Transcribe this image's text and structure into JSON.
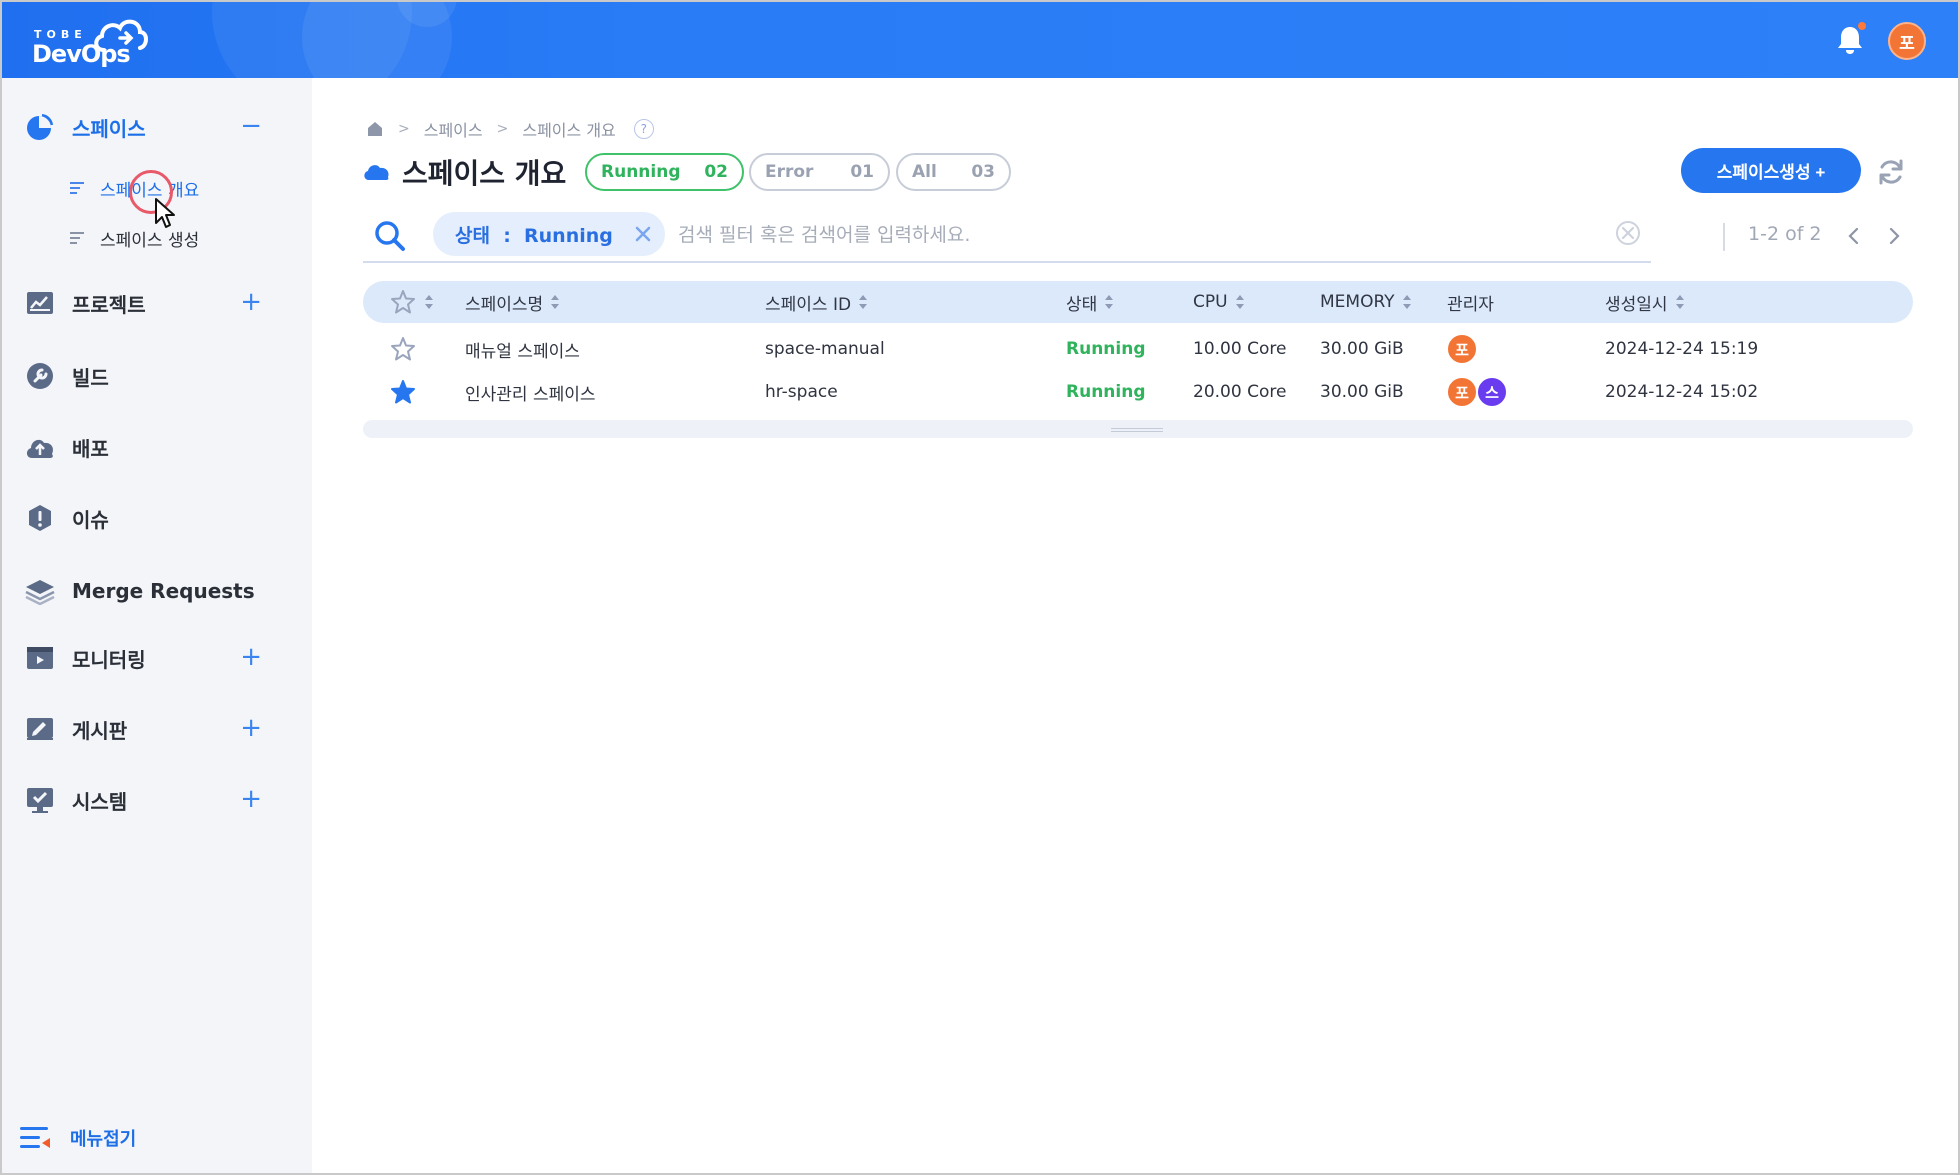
{
  "app": {
    "logo_small": "TOBE",
    "logo_main": "DevOps",
    "user_initial": "포"
  },
  "colors": {
    "brand": "#2676f0",
    "running": "#2fb35c",
    "avatar_orange": "#f27535",
    "avatar_purple": "#6a3cf0"
  },
  "sidebar": {
    "items": [
      {
        "label": "스페이스",
        "icon": "pie-chart-icon",
        "toggle": "−"
      },
      {
        "label": "프로젝트",
        "icon": "project-chart-icon",
        "toggle": "+"
      },
      {
        "label": "빌드",
        "icon": "wrench-icon",
        "toggle": ""
      },
      {
        "label": "배포",
        "icon": "cloud-upload-icon",
        "toggle": ""
      },
      {
        "label": "이슈",
        "icon": "alert-icon",
        "toggle": ""
      },
      {
        "label": "Merge Requests",
        "icon": "layers-icon",
        "toggle": ""
      },
      {
        "label": "모니터링",
        "icon": "monitor-icon",
        "toggle": "+"
      },
      {
        "label": "게시판",
        "icon": "board-icon",
        "toggle": "+"
      },
      {
        "label": "시스템",
        "icon": "system-icon",
        "toggle": "+"
      }
    ],
    "sub_items": [
      {
        "label": "스페이스 개요"
      },
      {
        "label": "스페이스 생성"
      }
    ],
    "fold_label": "메뉴접기"
  },
  "breadcrumb": [
    "스페이스",
    "스페이스 개요"
  ],
  "help": "?",
  "page_title": "스페이스 개요",
  "status_chips": [
    {
      "label": "Running",
      "count": "02"
    },
    {
      "label": "Error",
      "count": "01"
    },
    {
      "label": "All",
      "count": "03"
    }
  ],
  "create_button": "스페이스생성 +",
  "search": {
    "filter_label": "상태  :  Running",
    "placeholder": "검색 필터 혹은 검색어를 입력하세요."
  },
  "pager": {
    "text": "1-2 of 2"
  },
  "table": {
    "headers": [
      "스페이스명",
      "스페이스 ID",
      "상태",
      "CPU",
      "MEMORY",
      "관리자",
      "생성일시"
    ],
    "rows": [
      {
        "starred": false,
        "name": "매뉴얼 스페이스",
        "id": "space-manual",
        "status": "Running",
        "cpu": "10.00 Core",
        "memory": "30.00 GiB",
        "admins": [
          "포"
        ],
        "created": "2024-12-24 15:19"
      },
      {
        "starred": true,
        "name": "인사관리 스페이스",
        "id": "hr-space",
        "status": "Running",
        "cpu": "20.00 Core",
        "memory": "30.00 GiB",
        "admins": [
          "포",
          "스"
        ],
        "created": "2024-12-24 15:02"
      }
    ]
  }
}
